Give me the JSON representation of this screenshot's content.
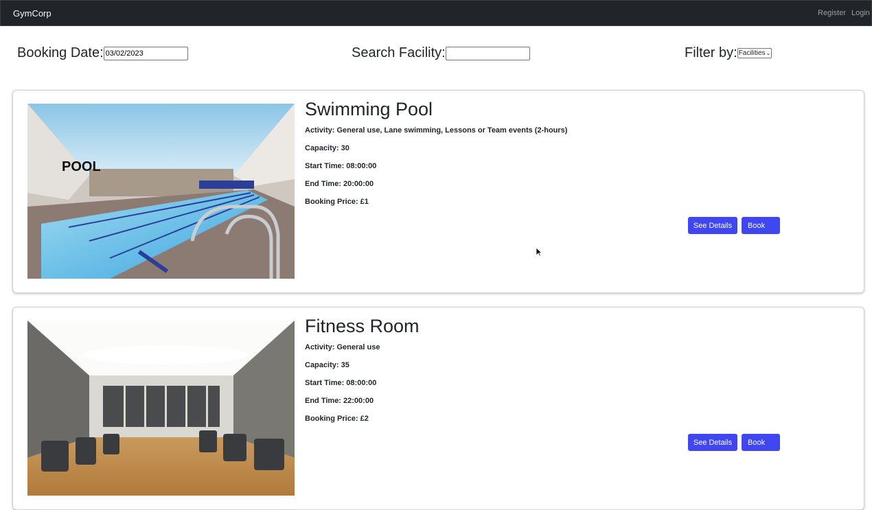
{
  "navbar": {
    "brand": "GymCorp",
    "register_label": "Register",
    "login_label": "Login"
  },
  "filters": {
    "booking_date_label": "Booking Date:",
    "booking_date_value": "03/02/2023",
    "search_label": "Search Facility:",
    "search_value": "",
    "filter_label": "Filter by:",
    "filter_selected": "Facilities"
  },
  "facilities": [
    {
      "name": "Swimming Pool",
      "activity": "Activity: General use, Lane swimming, Lessons or Team events (2-hours)",
      "capacity": "Capacity: 30",
      "start_time": "Start Time: 08:00:00",
      "end_time": "End Time: 20:00:00",
      "price": "Booking Price: £1",
      "image_sign": "POOL",
      "details_label": "See Details",
      "book_label": "Book"
    },
    {
      "name": "Fitness Room",
      "activity": "Activity: General use",
      "capacity": "Capacity: 35",
      "start_time": "Start Time: 08:00:00",
      "end_time": "End Time: 22:00:00",
      "price": "Booking Price: £2",
      "details_label": "See Details",
      "book_label": "Book"
    }
  ],
  "colors": {
    "navbar_bg": "#212529",
    "button_bg": "#4046f0"
  }
}
